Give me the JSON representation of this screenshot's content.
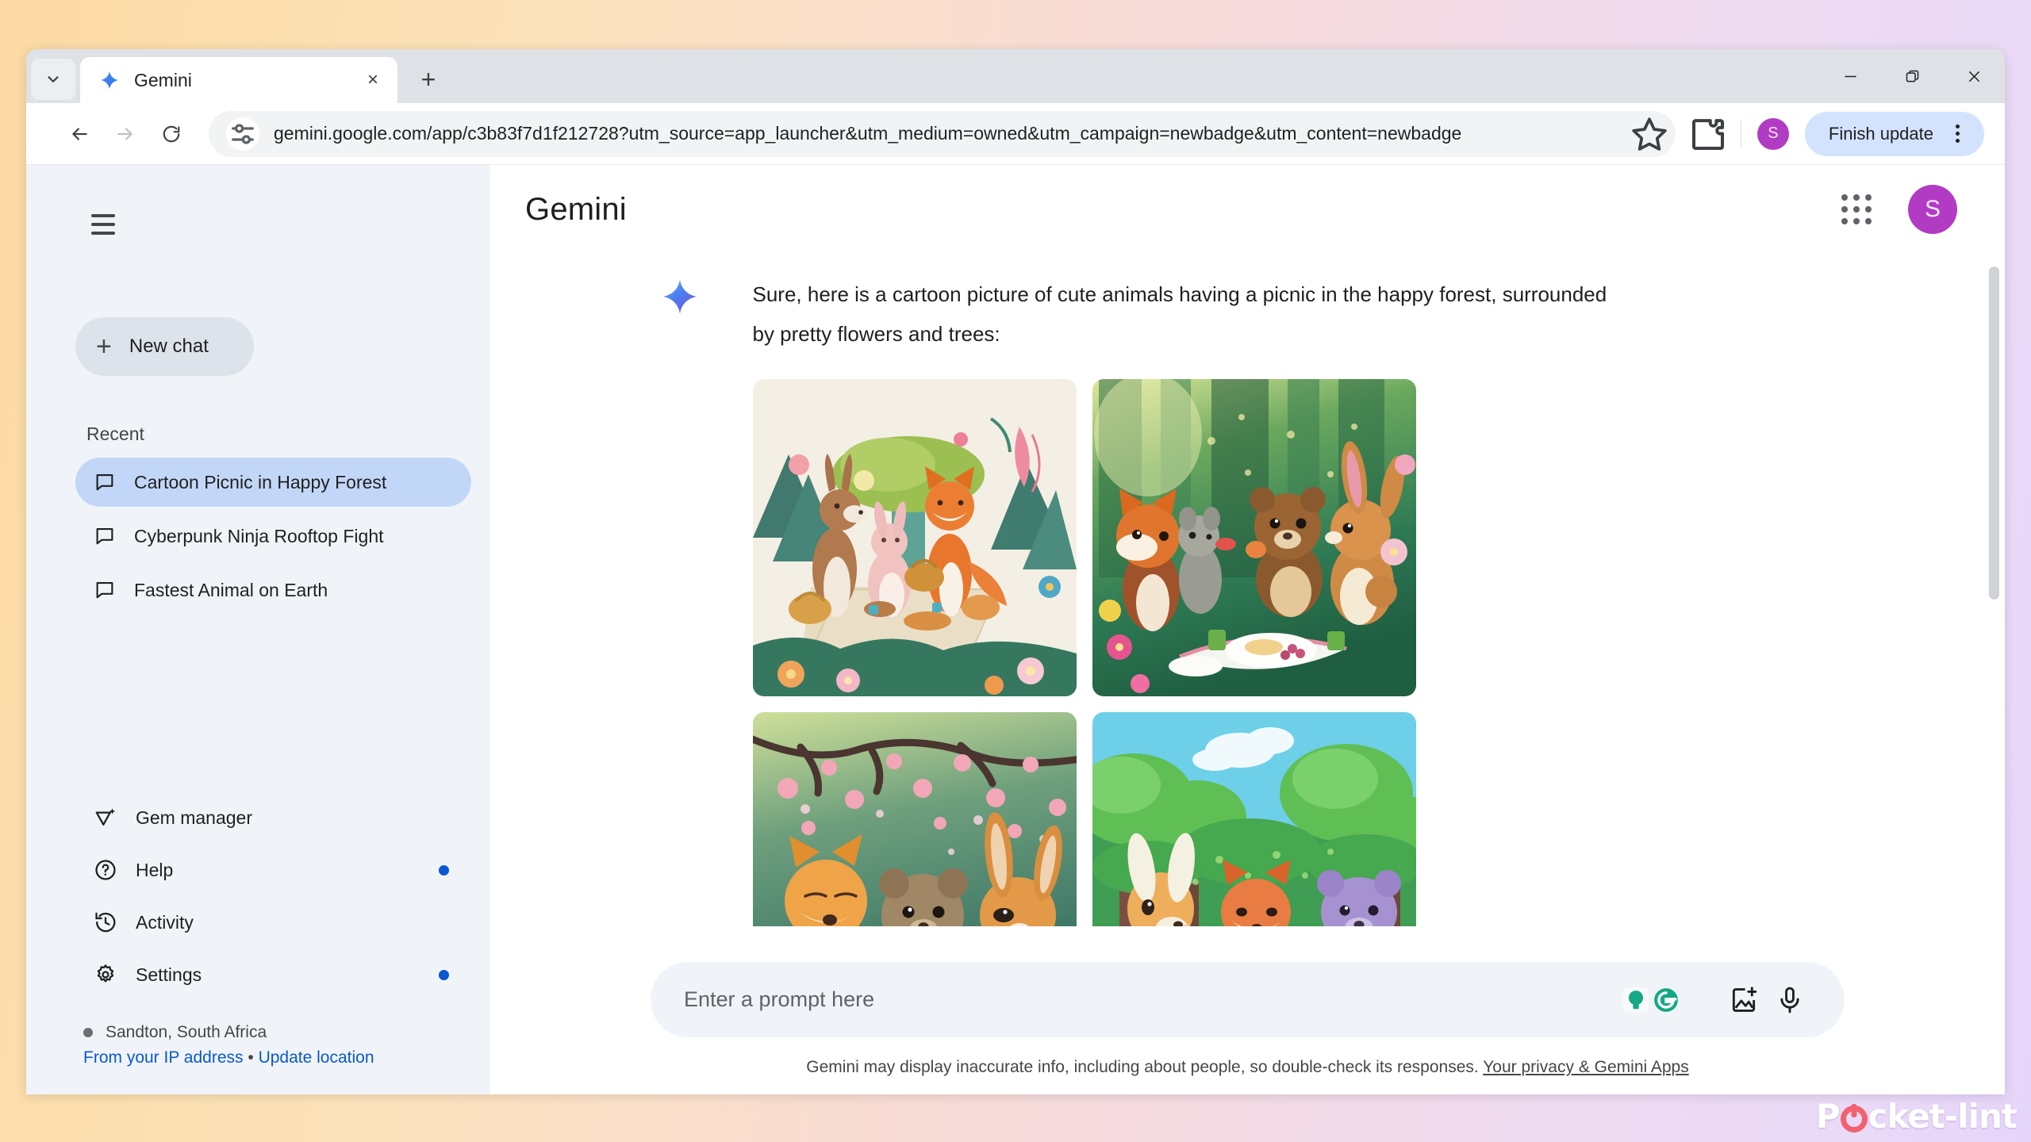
{
  "browser": {
    "tab": {
      "title": "Gemini",
      "favicon": "gemini-spark-icon",
      "close_label": "×"
    },
    "new_tab_label": "+",
    "window_controls": {
      "minimize": "minimize-icon",
      "maximize": "restore-icon",
      "close": "close-icon"
    },
    "toolbar": {
      "back": "back-arrow-icon",
      "forward": "forward-arrow-icon",
      "reload": "reload-icon",
      "site_settings": "tune-icon",
      "url": "gemini.google.com/app/c3b83f7d1f212728?utm_source=app_launcher&utm_medium=owned&utm_campaign=newbadge&utm_content=newbadge",
      "bookmark": "star-icon",
      "extensions": "puzzle-piece-icon",
      "profile_initial": "S",
      "profile_color": "#b23bc4",
      "finish_update_label": "Finish update",
      "finish_update_color": "#d3e3fd",
      "menu": "three-dot-menu-icon"
    }
  },
  "sidebar": {
    "hamburger": "hamburger-menu-icon",
    "new_chat": {
      "label": "New chat",
      "icon": "plus-icon"
    },
    "recent_label": "Recent",
    "chats": [
      {
        "label": "Cartoon Picnic in Happy Forest",
        "icon": "chat-bubble-icon",
        "active": true
      },
      {
        "label": "Cyberpunk Ninja Rooftop Fight",
        "icon": "chat-bubble-icon",
        "active": false
      },
      {
        "label": "Fastest Animal on Earth",
        "icon": "chat-bubble-icon",
        "active": false
      }
    ],
    "menu": [
      {
        "label": "Gem manager",
        "icon": "gem-icon",
        "badge": false
      },
      {
        "label": "Help",
        "icon": "help-circle-icon",
        "badge": true
      },
      {
        "label": "Activity",
        "icon": "history-icon",
        "badge": false
      },
      {
        "label": "Settings",
        "icon": "gear-icon",
        "badge": true
      }
    ],
    "location": {
      "name": "Sandton, South Africa",
      "source_link": "From your IP address",
      "separator": "•",
      "update_link": "Update location"
    },
    "badge_color": "#0b57d0",
    "active_chat_color": "#c2d7f8"
  },
  "app": {
    "title": "Gemini",
    "apps_grid": "apps-grid-icon",
    "account_initial": "S",
    "account_color": "#b23bc4"
  },
  "conversation": {
    "model_icon": "gemini-spark-icon",
    "response_text": "Sure, here is a cartoon picture of cute animals having a picnic in the happy forest, surrounded by pretty flowers and trees:",
    "images": [
      {
        "alt": "Pastel illustration of a deer, pink rabbit and fox picnicking under a broccoli-like tree among flowers"
      },
      {
        "alt": "Lush green forest picnic with a fox, grey mouse, brown bear cub and a rabbit"
      },
      {
        "alt": "Cherry blossom picnic with an orange fox, brown bear cub and a rabbit"
      },
      {
        "alt": "Bright cartoon forest picnic with a deer, fox and purple bear under green trees"
      }
    ]
  },
  "prompt": {
    "placeholder": "Enter a prompt here",
    "value": "",
    "grammarly_icon": "grammarly-icon",
    "image_upload_icon": "add-image-icon",
    "mic_icon": "microphone-icon"
  },
  "footer": {
    "disclaimer": "Gemini may display inaccurate info, including about people, so double-check its responses.",
    "privacy_link": "Your privacy & Gemini Apps"
  },
  "watermark": {
    "text_before": "P",
    "text_after": "cket-lint",
    "icon": "power-icon"
  }
}
